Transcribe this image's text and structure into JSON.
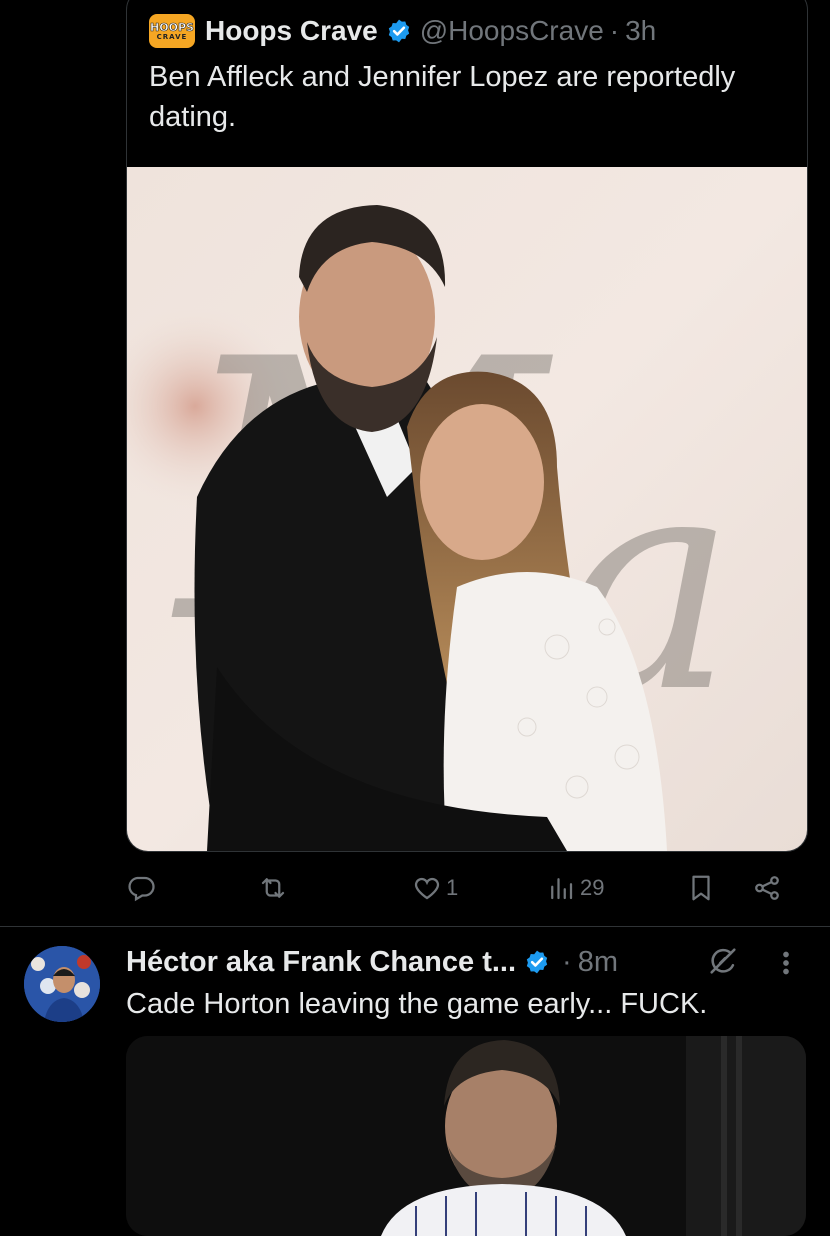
{
  "quote": {
    "avatar_top": "HOOPS",
    "avatar_bottom": "CRAVE",
    "name": "Hoops Crave",
    "handle": "@HoopsCrave",
    "dot": "·",
    "time": "3h",
    "text": "Ben Affleck and Jennifer Lopez are reportedly dating.",
    "image_icon": "photo-couple-embrace"
  },
  "actions": {
    "reply_count": "",
    "retweet_count": "",
    "like_count": "1",
    "views_count": "29",
    "icons": [
      "reply-icon",
      "retweet-icon",
      "like-icon",
      "views-icon",
      "bookmark-icon",
      "share-icon"
    ]
  },
  "tweet2": {
    "name": "Héctor aka Frank Chance t...",
    "dot": "·",
    "time": "8m",
    "text": "Cade Horton leaving the game early... FUCK."
  },
  "colors": {
    "background": "#000000",
    "text": "#e7e9ea",
    "muted": "#71767b",
    "verified": "#1d9bf0",
    "border": "#2f3336"
  }
}
